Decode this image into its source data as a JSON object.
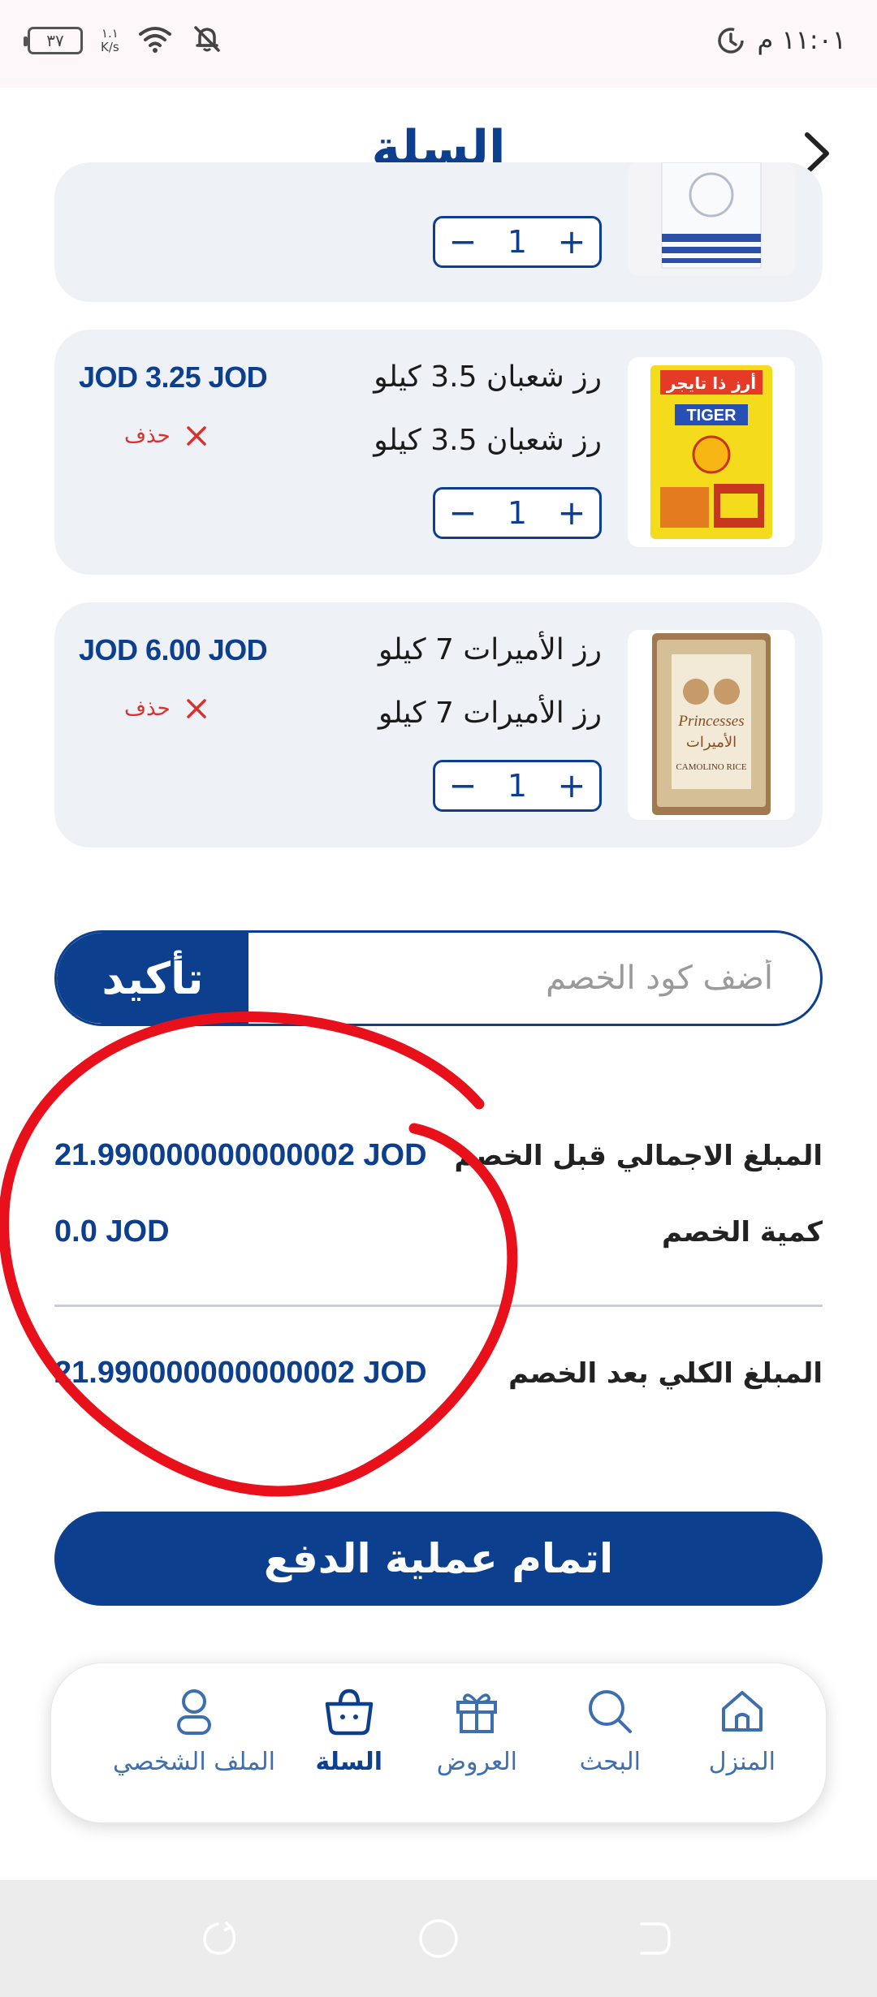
{
  "status_bar": {
    "time": "١١:٠١ م",
    "speed_top": "١.١",
    "speed_bottom": "K/s",
    "battery": "٣٧"
  },
  "header": {
    "title": "السلة",
    "back_icon": "chevron-right-icon"
  },
  "cart": {
    "items": [
      {
        "name": "",
        "subtitle": "",
        "quantity": "1",
        "price": "",
        "delete_label": ""
      },
      {
        "name": "رز شعبان 3.5 كيلو",
        "subtitle": "رز شعبان 3.5 كيلو",
        "quantity": "1",
        "price": "JOD 3.25 JOD",
        "delete_label": "حذف",
        "image_text": "TIGER",
        "image_text_ar": "أرز ذا تايجر"
      },
      {
        "name": "رز الأميرات 7 كيلو",
        "subtitle": "رز الأميرات 7 كيلو",
        "quantity": "1",
        "price": "JOD 6.00 JOD",
        "delete_label": "حذف",
        "image_text": "Princesses",
        "image_text_ar": "الأميرات",
        "image_sub": "CAMOLINO RICE"
      }
    ],
    "plus": "+",
    "minus": "−"
  },
  "discount": {
    "placeholder": "أضف كود الخصم",
    "confirm_label": "تأكيد"
  },
  "summary": {
    "subtotal_label": "المبلغ الاجمالي قبل الخصم",
    "subtotal_value": "21.990000000000002 JOD",
    "discount_label": "كمية الخصم",
    "discount_value": "0.0 JOD",
    "total_label": "المبلغ الكلي بعد الخصم",
    "total_value": "21.990000000000002 JOD"
  },
  "checkout": {
    "label": "اتمام عملية الدفع"
  },
  "bottom_nav": {
    "items": [
      {
        "label": "المنزل",
        "icon": "home-icon"
      },
      {
        "label": "البحث",
        "icon": "search-icon"
      },
      {
        "label": "العروض",
        "icon": "gift-icon"
      },
      {
        "label": "السلة",
        "icon": "basket-icon",
        "active": true
      },
      {
        "label": "الملف الشخصي",
        "icon": "user-icon"
      }
    ]
  },
  "colors": {
    "primary": "#0d3f8f",
    "card_bg": "#eef2f7",
    "delete": "#d9322c",
    "annotation": "#e8101a"
  }
}
